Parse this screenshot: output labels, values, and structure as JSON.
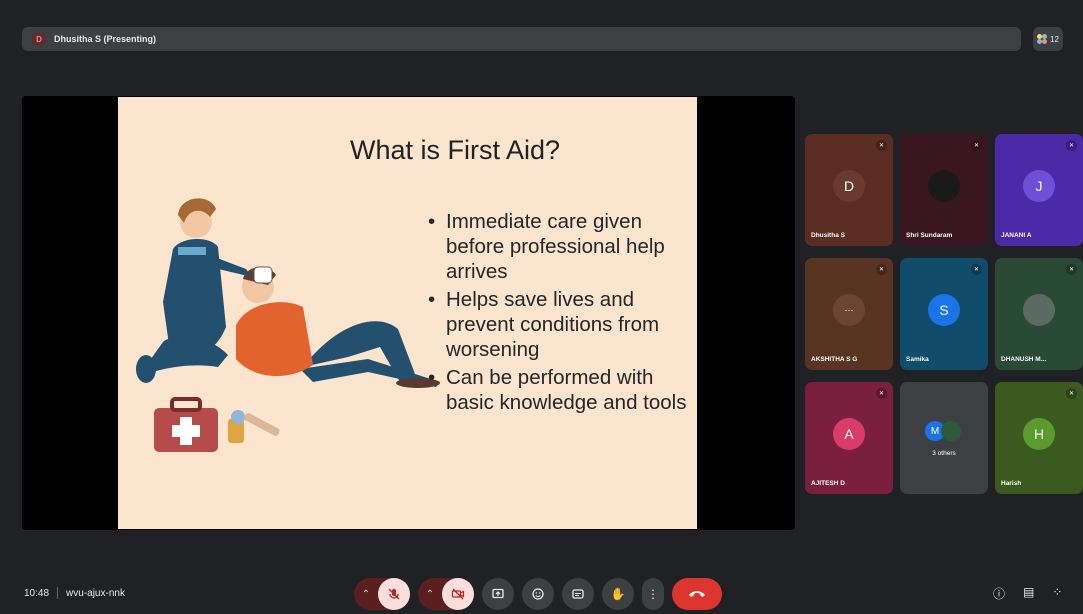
{
  "meeting": {
    "presenter_banner": "Dhusitha S (Presenting)",
    "presenter_initial": "D",
    "participant_count": "12",
    "time": "10:48",
    "meeting_code": "wvu-ajux-nnk"
  },
  "slide": {
    "title": "What is First Aid?",
    "bullets": [
      "Immediate care given before professional help arrives",
      "Helps save lives and prevent conditions from worsening",
      "Can be performed with basic knowledge and tools"
    ]
  },
  "participants": [
    {
      "name": "Dhusitha S",
      "initial": "D",
      "tile_color": "#5b2c22",
      "avatar_color": "#6a3a2e"
    },
    {
      "name": "Shri Sundaram",
      "initial": "",
      "tile_color": "#3a1620",
      "avatar_color": "#1a1a1a"
    },
    {
      "name": "JANANI A",
      "initial": "J",
      "tile_color": "#4a2aa6",
      "avatar_color": "#6f4fd6"
    },
    {
      "name": "AKSHITHA S G",
      "initial": "",
      "tile_color": "#5a3422",
      "avatar_color": "#6b4434"
    },
    {
      "name": "Samika",
      "initial": "S",
      "tile_color": "#0f4d6a",
      "avatar_color": "#1a73e8"
    },
    {
      "name": "DHANUSH M...",
      "initial": "",
      "tile_color": "#2a4a36",
      "avatar_color": "#5b6b63"
    },
    {
      "name": "AJITESH D",
      "initial": "A",
      "tile_color": "#7a1f3d",
      "avatar_color": "#d93b6a"
    },
    {
      "name": "",
      "initial": "",
      "tile_color": "#3c4043",
      "avatar_color": "#3c4043"
    },
    {
      "name": "Harish",
      "initial": "H",
      "tile_color": "#3a5a1f",
      "avatar_color": "#5a9a2e"
    }
  ],
  "others_tile": {
    "label": "3 others",
    "initial": "M"
  },
  "controls": {
    "mic_icon": "mic-off-icon",
    "camera_icon": "camera-off-icon",
    "present_icon": "present-screen-icon",
    "emoji_icon": "emoji-icon",
    "captions_icon": "captions-icon",
    "raise_hand_icon": "raise-hand-icon",
    "more_icon": "more-options-icon",
    "hangup_icon": "end-call-icon",
    "info_icon": "info-icon",
    "chat_icon": "chat-icon",
    "activities_icon": "activities-icon"
  },
  "colors": {
    "background": "#202124",
    "slide_bg": "#fbe5cf",
    "hangup": "#dc362e"
  }
}
